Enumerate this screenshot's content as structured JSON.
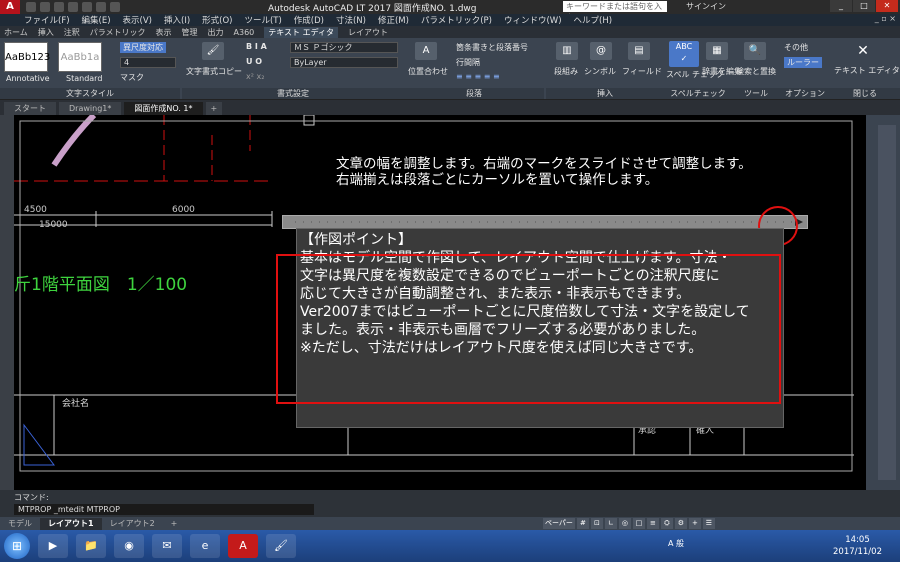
{
  "titlebar": {
    "title": "Autodesk AutoCAD LT 2017   図面作成NO. 1.dwg",
    "search_placeholder": "キーワードまたは語句を入力",
    "signin": "サインイン"
  },
  "menubar": [
    "ファイル(F)",
    "編集(E)",
    "表示(V)",
    "挿入(I)",
    "形式(O)",
    "ツール(T)",
    "作成(D)",
    "寸法(N)",
    "修正(M)",
    "パラメトリック(P)",
    "ウィンドウ(W)",
    "ヘルプ(H)"
  ],
  "ribbon_tabs": [
    "ホーム",
    "挿入",
    "注釈",
    "パラメトリック",
    "表示",
    "管理",
    "出力",
    "A360",
    "テキスト エディタ",
    "レイアウト"
  ],
  "ribbon": {
    "style_annotative": "AaBb123",
    "style_standard": "AaBb1a",
    "style_annotative_name": "Annotative",
    "style_standard_name": "Standard",
    "annot_scale": "異尺度対応",
    "height_value": "4",
    "mask": "マスク",
    "text_style_group": "文字スタイル",
    "copy_format": "文字書式コピー",
    "font_value": "ＭＳ Ｐゴシック",
    "color_value": "ByLayer",
    "format_group": "書式設定",
    "justify": "位置合わせ",
    "bullets": "箇条書きと段落番号",
    "line_spacing": "行間隔",
    "paragraph_group": "段落",
    "columns": "段組み",
    "symbol": "シンボル",
    "field": "フィールド",
    "insert_group": "挿入",
    "spell_check": "スペル チェック",
    "dictionary": "辞書を編集",
    "spell_group": "スペルチェック",
    "find_replace": "検索と置換",
    "tools_group": "ツール",
    "more": "その他",
    "ruler": "ルーラー",
    "options_group": "オプション",
    "close_editor": "テキスト エディタを閉じる",
    "close_group": "閉じる"
  },
  "doc_tabs": [
    "スタート",
    "Drawing1*",
    "図面作成NO. 1*"
  ],
  "canvas": {
    "instruction": "文章の幅を調整します。右端のマークをスライドさせて調整します。右端揃えは段落ごとにカーソルを置いて操作します。",
    "plan_title": "斤1階平面図　1／100",
    "dim_4500": "4500",
    "dim_6000": "6000",
    "dim_15000": "15000",
    "company": "会社名",
    "mtext_lines": [
      "【作図ポイント】",
      "基本はモデル空間で作図して、レイアウト空間で仕上げます。寸法・",
      "文字は異尺度を複数設定できるのでビューポートごとの注釈尺度に",
      "応じて大きさが自動調整され、また表示・非表示もできます。",
      "Ver2007まではビューポートごとに尺度倍数して寸法・文字を設定して",
      "ました。表示・非表示も画層でフリーズする必要がありました。",
      "※ただし、寸法だけはレイアウト尺度を使えば同じ大きさです。"
    ],
    "cell_a": "承認",
    "cell_b": "確人"
  },
  "command": {
    "label": "コマンド:",
    "input": "MTPROP _mtedit MTPROP"
  },
  "status": {
    "layout_tabs": [
      "モデル",
      "レイアウト1",
      "レイアウト2"
    ],
    "paper": "ペーパー"
  },
  "taskbar": {
    "clock_time": "14:05",
    "clock_date": "2017/11/02",
    "ime": "A 般"
  },
  "colors": {
    "accent_red": "#e01010",
    "plan_green": "#3ed33e",
    "cad_red": "#d01010"
  }
}
